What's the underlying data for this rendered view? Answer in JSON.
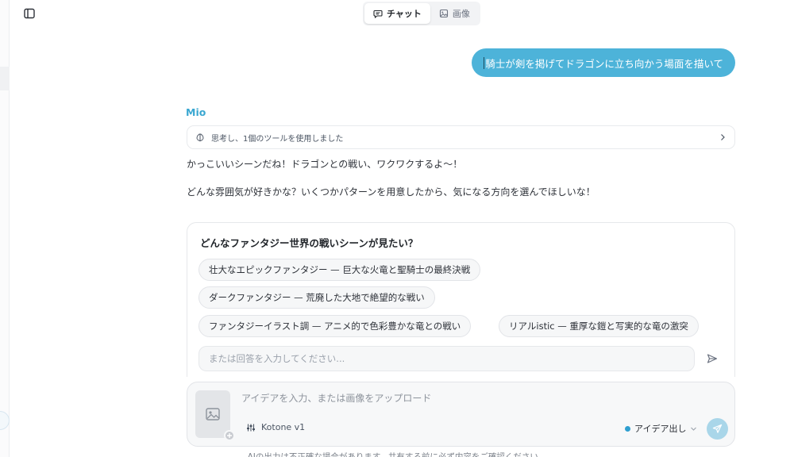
{
  "header": {
    "tabs": [
      {
        "label": "チャット",
        "icon": "chat-icon",
        "active": true
      },
      {
        "label": "画像",
        "icon": "image-icon",
        "active": false
      }
    ]
  },
  "conversation": {
    "user_message": "騎士が剣を掲げてドラゴンに立ち向かう場面を描いて",
    "assistant_name": "Mio",
    "thought_summary": "思考し、1個のツールを使用しました",
    "paragraphs": [
      "かっこいいシーンだね！ドラゴンとの戦い、ワクワクするよ〜！",
      "どんな雰囲気が好きかな？いくつかパターンを用意したから、気になる方向を選んでほしいな！"
    ],
    "question": {
      "title": "どんなファンタジー世界の戦いシーンが見たい？",
      "options": [
        "壮大なエピックファンタジー — 巨大な火竜と聖騎士の最終決戦",
        "ダークファンタジー — 荒廃した大地で絶望的な戦い",
        "ファンタジーイラスト調 — アニメ的で色彩豊かな竜との戦い",
        "リアルistic — 重厚な鎧と写実的な竜の激突"
      ],
      "answer_placeholder": "または回答を入力してください..."
    }
  },
  "composer": {
    "placeholder": "アイデアを入力、または画像をアップロード",
    "model": "Kotone v1",
    "mode": "アイデア出し"
  },
  "footer": {
    "disclaimer": "AIの出力は不正確な場合があります。共有する前に必ず内容をご確認ください。"
  },
  "colors": {
    "accent": "#4db3d9",
    "accent_text": "#3aa7d1",
    "send_disabled": "#a9d6e9"
  }
}
